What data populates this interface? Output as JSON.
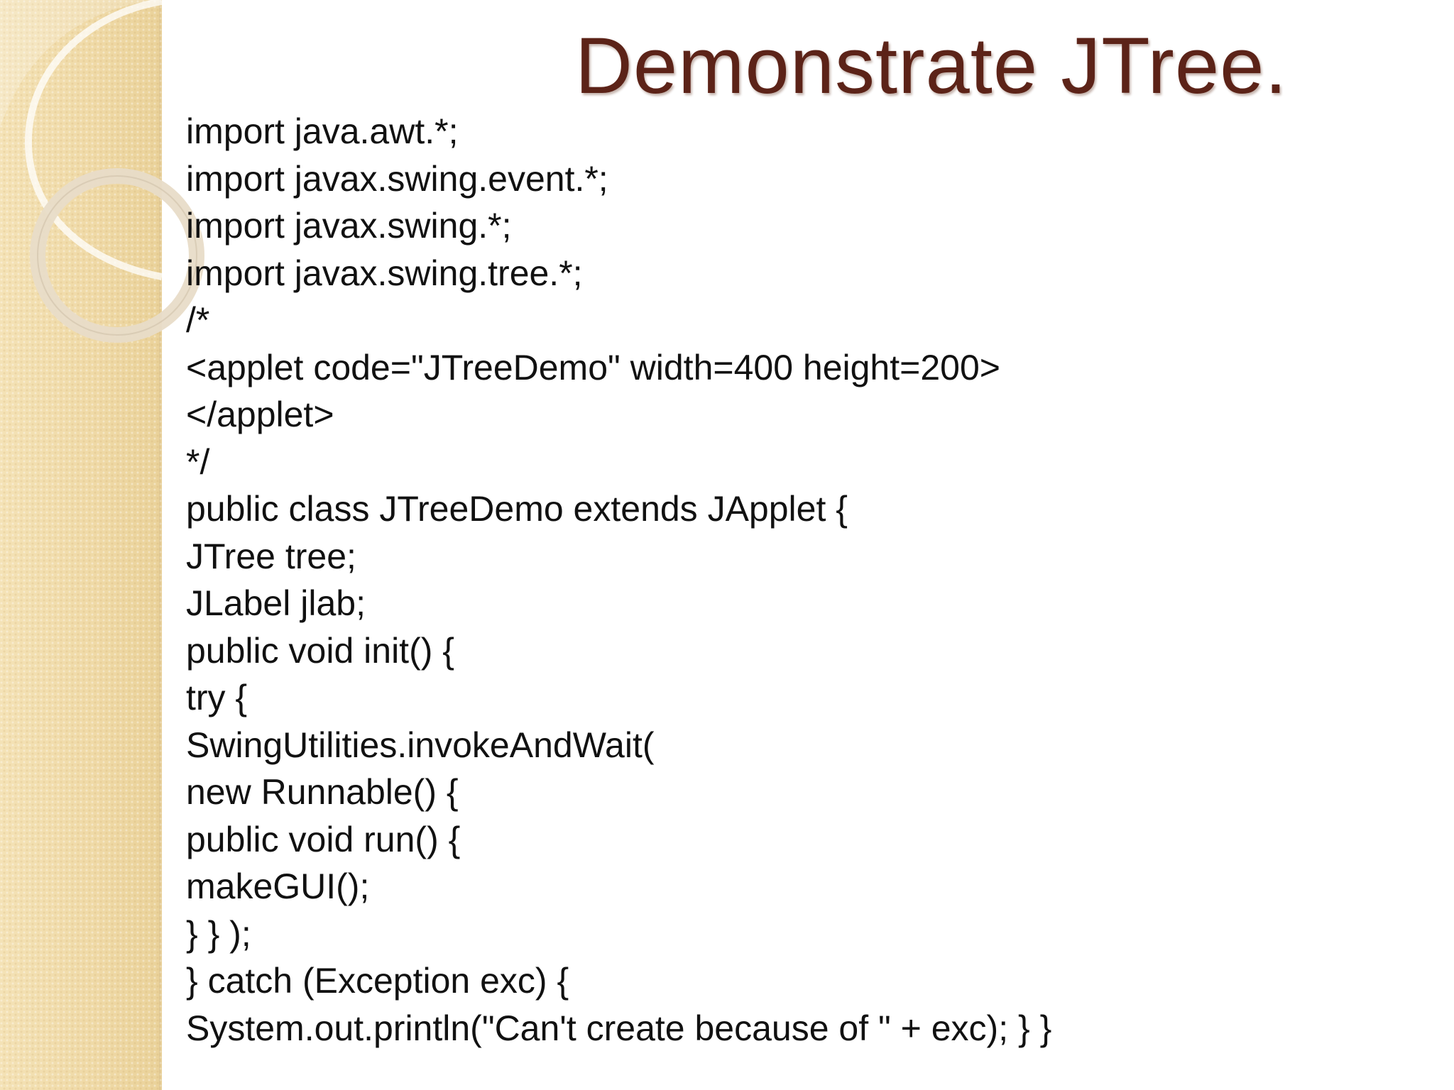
{
  "slide": {
    "title": "Demonstrate JTree.",
    "code_lines": [
      "import java.awt.*;",
      "import javax.swing.event.*;",
      "import javax.swing.*;",
      "import javax.swing.tree.*;",
      "/*",
      "<applet code=\"JTreeDemo\" width=400 height=200>",
      "</applet>",
      "*/",
      "public class JTreeDemo extends JApplet {",
      "JTree tree;",
      "JLabel jlab;",
      "public void init() {",
      "try {",
      "SwingUtilities.invokeAndWait(",
      "new Runnable() {",
      "public void run() {",
      "makeGUI();",
      "} } );",
      "} catch (Exception exc) {",
      "System.out.println(\"Can't create because of \" + exc); } }"
    ]
  },
  "colors": {
    "title": "#5c2318",
    "code_text": "#111111",
    "side_band": "#f2dfb1",
    "background": "#ffffff"
  }
}
